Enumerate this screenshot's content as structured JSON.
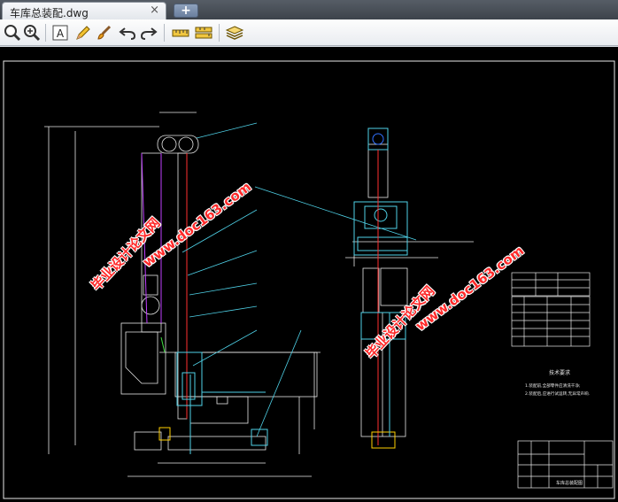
{
  "tab": {
    "title": "车库总装配.dwg",
    "close_glyph": "×",
    "new_tab_glyph": "+"
  },
  "toolbar": {
    "buttons": [
      {
        "name": "zoom-icon"
      },
      {
        "name": "zoom-extents-icon"
      },
      {
        "name": "text-icon",
        "glyph": "A"
      },
      {
        "name": "pencil-icon"
      },
      {
        "name": "brush-icon"
      },
      {
        "name": "undo-icon"
      },
      {
        "name": "redo-icon"
      },
      {
        "name": "measure-icon"
      },
      {
        "name": "measure-area-icon"
      },
      {
        "name": "layers-icon"
      }
    ]
  },
  "drawing": {
    "watermarks": [
      {
        "line1": "毕业设计论文网",
        "line2": "www.doc163.com"
      },
      {
        "line1": "毕业设计论文网",
        "line2": "www.doc163.com"
      }
    ],
    "notes_title": "技术要求",
    "notes_lines": [
      "1.装配前,全部零件应清洗干净;",
      "2.装配后,应进行试运转,无异常声响."
    ],
    "title_block": {
      "drawing_name": "车库总装配图"
    }
  },
  "colors": {
    "canvas": "#000000",
    "watermark": "#ff2a2a",
    "cad_cyan": "#4fd2e8",
    "cad_white": "#e8e8e8",
    "cad_magenta": "#c040ff"
  }
}
